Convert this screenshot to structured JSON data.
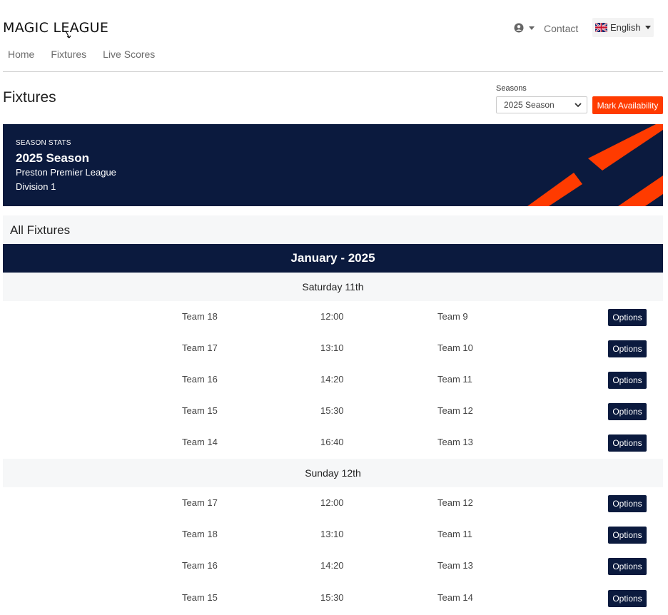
{
  "header": {
    "logo_text": "MAGIC LEAGUE",
    "nav": [
      "Home",
      "Fixtures",
      "Live Scores"
    ],
    "contact": "Contact",
    "language": "English"
  },
  "page": {
    "title": "Fixtures",
    "seasons_label": "Seasons",
    "season_selected": "2025 Season",
    "mark_availability": "Mark Availability"
  },
  "banner": {
    "label": "SEASON STATS",
    "season": "2025 Season",
    "league": "Preston Premier League",
    "division": "Division 1"
  },
  "fixtures": {
    "heading": "All Fixtures",
    "month": "January - 2025",
    "days": [
      {
        "label": "Saturday 11th",
        "matches": [
          {
            "home": "Team 18",
            "time": "12:00",
            "away": "Team 9",
            "action": "Options"
          },
          {
            "home": "Team 17",
            "time": "13:10",
            "away": "Team 10",
            "action": "Options"
          },
          {
            "home": "Team 16",
            "time": "14:20",
            "away": "Team 11",
            "action": "Options"
          },
          {
            "home": "Team 15",
            "time": "15:30",
            "away": "Team 12",
            "action": "Options"
          },
          {
            "home": "Team 14",
            "time": "16:40",
            "away": "Team 13",
            "action": "Options"
          }
        ]
      },
      {
        "label": "Sunday 12th",
        "matches": [
          {
            "home": "Team 17",
            "time": "12:00",
            "away": "Team 12",
            "action": "Options"
          },
          {
            "home": "Team 18",
            "time": "13:10",
            "away": "Team 11",
            "action": "Options"
          },
          {
            "home": "Team 16",
            "time": "14:20",
            "away": "Team 13",
            "action": "Options"
          },
          {
            "home": "Team 15",
            "time": "15:30",
            "away": "Team 14",
            "action": "Options"
          }
        ]
      }
    ]
  },
  "colors": {
    "navy": "#0b1a3e",
    "accent": "#ff3b00",
    "row_bg": "#f6f7f8"
  }
}
